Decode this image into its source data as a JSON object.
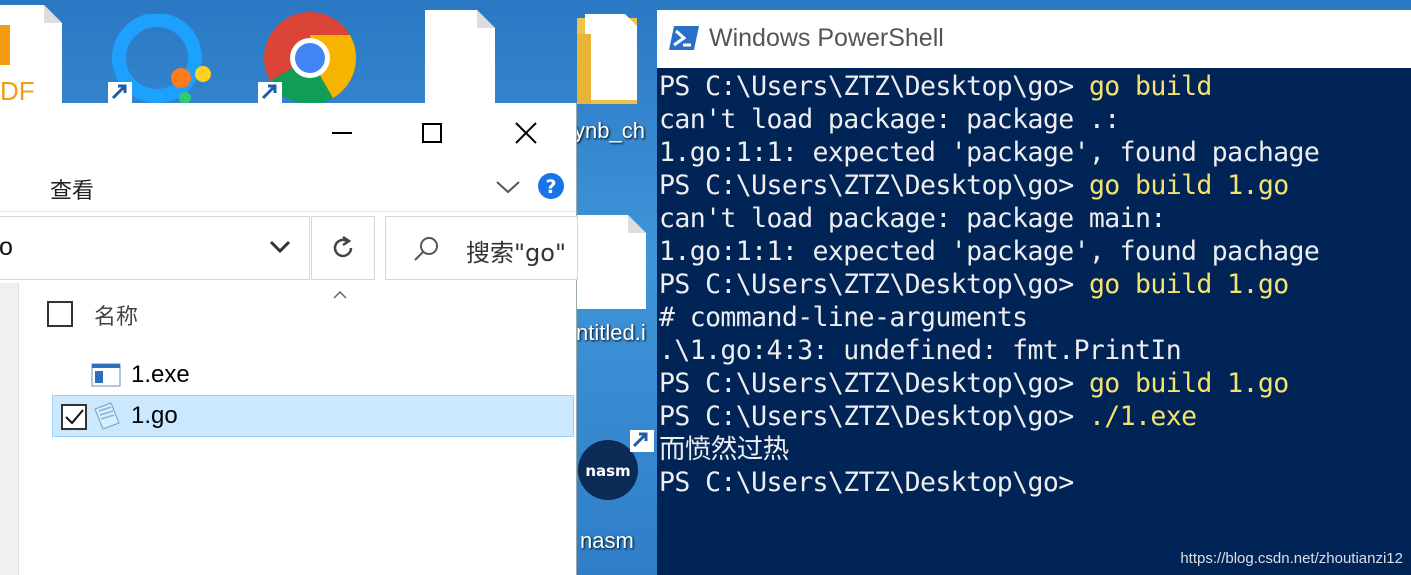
{
  "desktop": {
    "labels": {
      "folder": "ynb_ch",
      "untitled": "ntitled.i",
      "nasm": "nasm",
      "pdf": "DF"
    },
    "icons": [
      "pdf-icon",
      "qq-browser-icon",
      "chrome-icon",
      "blank-file-icon",
      "folder-icon",
      "blank-file-icon",
      "nasm-icon"
    ]
  },
  "explorer": {
    "ribbon_tab": "查看",
    "address": "o",
    "search_placeholder": "搜索\"go\"",
    "column_name": "名称",
    "files": [
      {
        "name": "1.exe",
        "selected": false,
        "icon": "exe-icon"
      },
      {
        "name": "1.go",
        "selected": true,
        "icon": "go-file-icon"
      }
    ],
    "colors": {
      "selection": "#cce8ff",
      "help": "#1a73e8"
    }
  },
  "powershell": {
    "title": "Windows PowerShell",
    "lines": [
      {
        "prompt": "PS C:\\Users\\ZTZ\\Desktop\\go> ",
        "cmd": "go build"
      },
      {
        "prompt": "can't load package: package .:",
        "cmd": ""
      },
      {
        "prompt": "1.go:1:1: expected 'package', found pachage",
        "cmd": ""
      },
      {
        "prompt": "PS C:\\Users\\ZTZ\\Desktop\\go> ",
        "cmd": "go build 1.go"
      },
      {
        "prompt": "can't load package: package main:",
        "cmd": ""
      },
      {
        "prompt": "1.go:1:1: expected 'package', found pachage",
        "cmd": ""
      },
      {
        "prompt": "PS C:\\Users\\ZTZ\\Desktop\\go> ",
        "cmd": "go build 1.go"
      },
      {
        "prompt": "# command-line-arguments",
        "cmd": ""
      },
      {
        "prompt": ".\\1.go:4:3: undefined: fmt.PrintIn",
        "cmd": ""
      },
      {
        "prompt": "PS C:\\Users\\ZTZ\\Desktop\\go> ",
        "cmd": "go build 1.go"
      },
      {
        "prompt": "PS C:\\Users\\ZTZ\\Desktop\\go> ",
        "cmd": "./1.exe"
      },
      {
        "prompt": "而愤然过热",
        "cmd": ""
      },
      {
        "prompt": "PS C:\\Users\\ZTZ\\Desktop\\go>",
        "cmd": ""
      }
    ],
    "colors": {
      "background": "#012456",
      "text": "#eeedf0",
      "command": "#f5e26f"
    }
  },
  "watermark": "https://blog.csdn.net/zhoutianzi12"
}
